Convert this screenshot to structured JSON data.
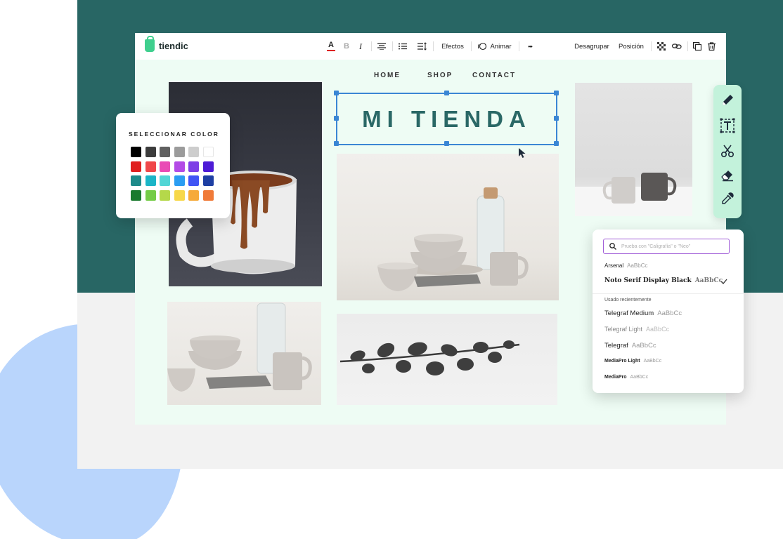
{
  "app": {
    "name": "tiendic"
  },
  "toolbar": {
    "text_color": "A",
    "bold": "B",
    "italic": "I",
    "effects": "Efectos",
    "animate": "Animar",
    "more": "•••",
    "ungroup": "Desagrupar",
    "position": "Posición"
  },
  "site_nav": {
    "items": [
      "HOME",
      "SHOP",
      "CONTACT"
    ]
  },
  "heading": "MI TIENDA",
  "color_picker": {
    "title": "SELECCIONAR COLOR",
    "swatches": [
      [
        "#000000",
        "#3c3c3c",
        "#606060",
        "#9b9b9b",
        "#cdcdcd",
        "#ffffff"
      ],
      [
        "#e02020",
        "#f0474a",
        "#e94bb5",
        "#b34be6",
        "#7d3fe6",
        "#4d1bd6"
      ],
      [
        "#1e8a8a",
        "#1bb5c7",
        "#52d6d6",
        "#2b9df2",
        "#4055f5",
        "#1e3fa3"
      ],
      [
        "#1a7a2e",
        "#74cc47",
        "#b5d84a",
        "#f7d84a",
        "#f6aa3a",
        "#f07a38"
      ]
    ]
  },
  "side_tools": [
    "pencil-icon",
    "text-frame-icon",
    "scissors-icon",
    "eraser-icon",
    "eyedropper-icon"
  ],
  "font_panel": {
    "search_placeholder": "Prueba con \"Caligrafía\" o \"Neo\"",
    "current": [
      {
        "name": "Arsenal",
        "sample": "AaBbCc"
      },
      {
        "name": "Noto Serif Display Black",
        "sample": "AaBbCc",
        "selected": true
      }
    ],
    "recent_label": "Usado recientemente",
    "recent": [
      {
        "name": "Telegraf Medium",
        "sample": "AaBbCc"
      },
      {
        "name": "Telegraf Light",
        "sample": "AaBbCc"
      },
      {
        "name": "Telegraf",
        "sample": "AaBbCc"
      },
      {
        "name": "MediaPro Light",
        "sample": "AaBbCc"
      },
      {
        "name": "MediaPro",
        "sample": "AaBbCc"
      }
    ]
  },
  "colors": {
    "teal": "#286664",
    "accent": "#3a86d4",
    "mint": "#eefcf4"
  }
}
